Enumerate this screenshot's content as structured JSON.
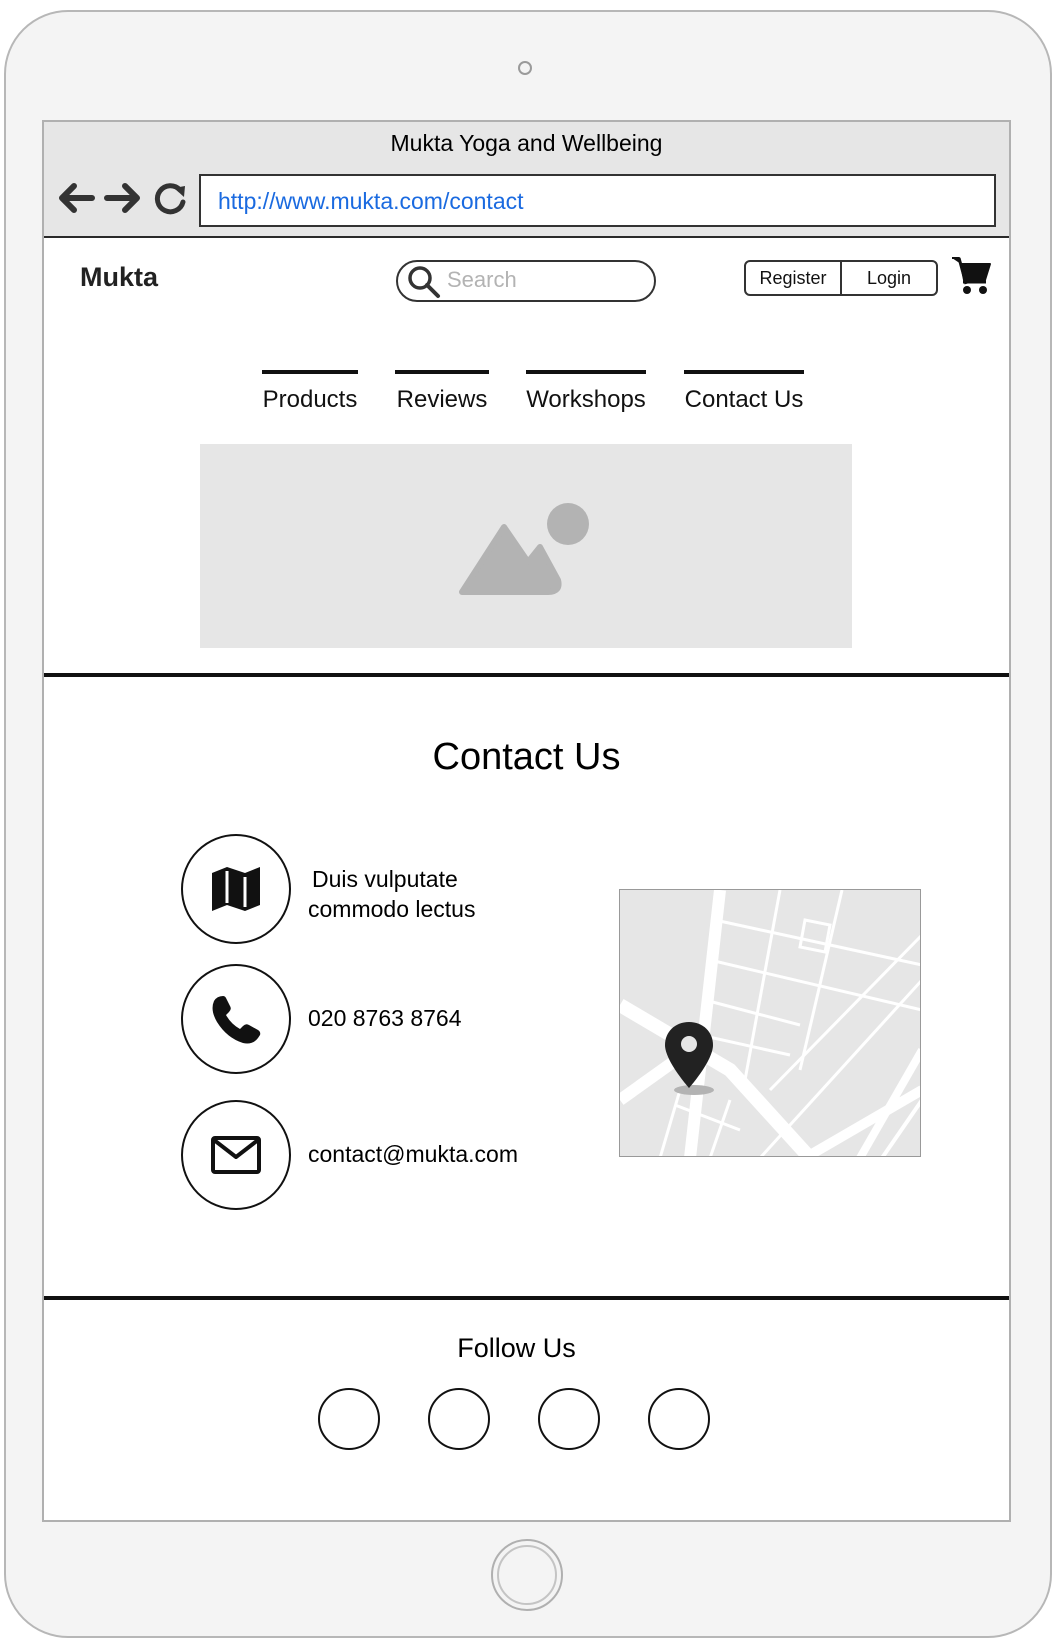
{
  "browser": {
    "window_title": "Mukta Yoga and Wellbeing",
    "url": "http://www.mukta.com/contact"
  },
  "header": {
    "brand": "Mukta",
    "search_placeholder": "Search",
    "register_label": "Register",
    "login_label": "Login"
  },
  "nav": {
    "items": [
      {
        "label": "Products"
      },
      {
        "label": "Reviews"
      },
      {
        "label": "Workshops"
      },
      {
        "label": "Contact Us"
      }
    ]
  },
  "contact": {
    "title": "Contact Us",
    "address_line1": "Duis vulputate",
    "address_line2": "commodo lectus",
    "phone": "020 8763 8764",
    "email": "contact@mukta.com"
  },
  "footer": {
    "follow_title": "Follow Us",
    "social_count": 4
  },
  "colors": {
    "url_link": "#1a6ae0",
    "placeholder": "#b3b3b3",
    "image_placeholder_bg": "#e6e6e6"
  },
  "icons": [
    "back-arrow-icon",
    "forward-arrow-icon",
    "refresh-icon",
    "search-icon",
    "cart-icon",
    "image-placeholder-icon",
    "map-icon",
    "phone-icon",
    "mail-icon",
    "map-pin-icon"
  ]
}
